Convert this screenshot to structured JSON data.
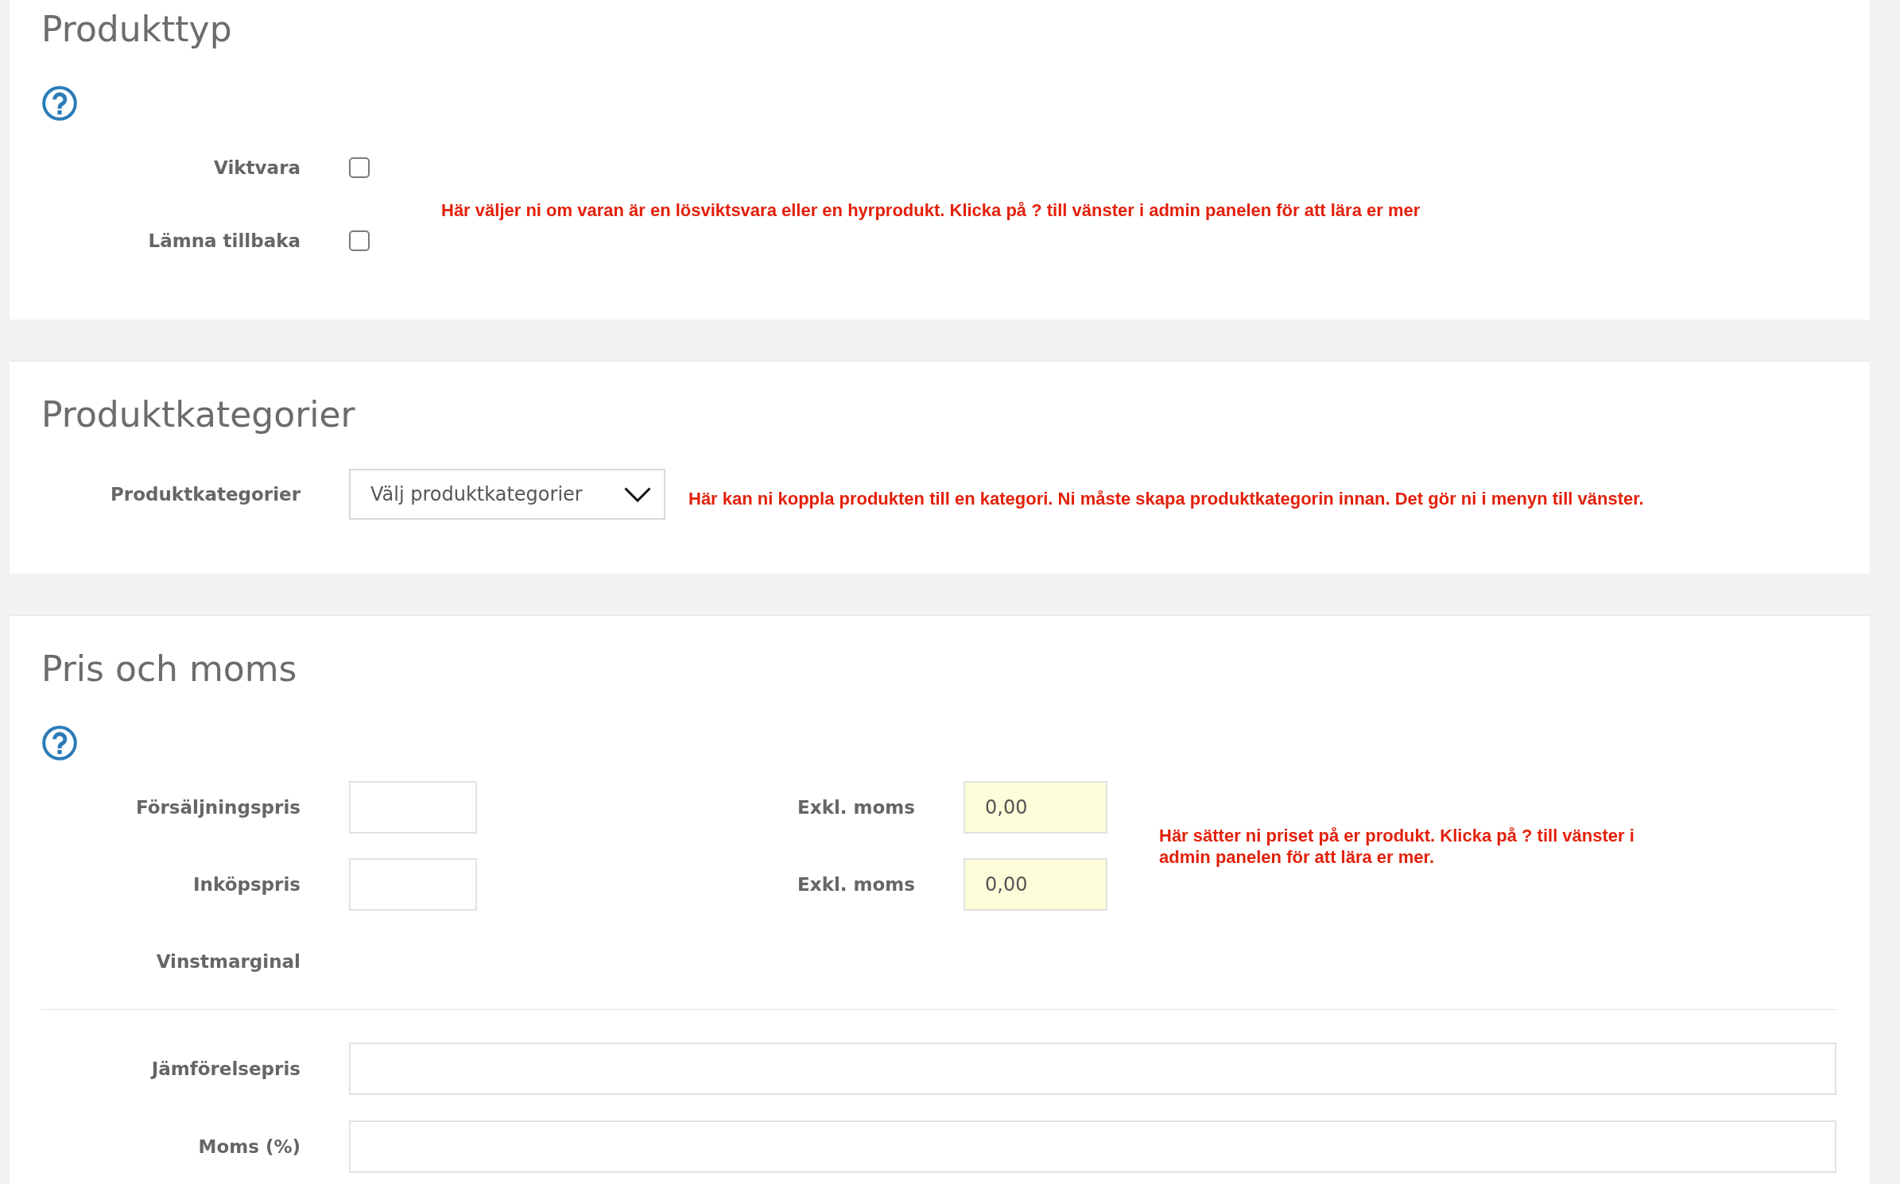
{
  "sections": [
    {
      "kind": "checkboxes",
      "title": "Produkttyp",
      "help": true,
      "rows": [
        {
          "kind": "checkbox",
          "label": "Viktvara",
          "checked": false
        },
        {
          "kind": "checkbox",
          "label": "Lämna tillbaka",
          "checked": false
        }
      ],
      "hint": "Här väljer ni om varan är en lösviktsvara eller en hyrprodukt. Klicka på ? till vänster i admin panelen för att lära er mer"
    },
    {
      "kind": "category",
      "title": "Produktkategorier",
      "rows": [
        {
          "kind": "select",
          "label": "Produktkategorier",
          "placeholder": "Välj produktkategorier"
        }
      ],
      "hint": "Här kan ni koppla produkten till en kategori. Ni måste skapa produktkategorin innan. Det gör ni i menyn till vänster."
    },
    {
      "kind": "pricing",
      "title": "Pris och moms",
      "help": true,
      "rows": [
        {
          "kind": "price",
          "label": "Försäljningspris",
          "net_label": "Exkl. moms",
          "net_value": "0,00"
        },
        {
          "kind": "price",
          "label": "Inköpspris",
          "net_label": "Exkl. moms",
          "net_value": "0,00"
        }
      ],
      "hint": "Här sätter ni priset på er produkt. Klicka på ? till vänster i admin panelen för att lära er mer.",
      "rows_below": [
        {
          "kind": "text",
          "label": "Vinstmarginal"
        }
      ],
      "rows_after_divider": [
        {
          "kind": "input",
          "label": "Jämförelsepris"
        },
        {
          "kind": "input",
          "label": "Moms (%)"
        }
      ]
    }
  ]
}
